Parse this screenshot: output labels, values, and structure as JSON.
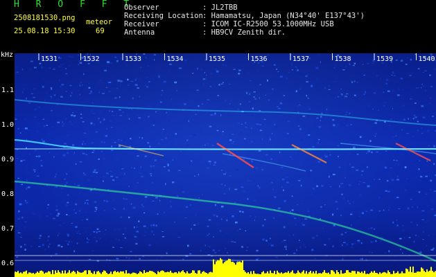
{
  "header": {
    "logo": "H R O F F T",
    "filename": "2508181530.png",
    "timestamp": "25.08.18 15:30",
    "meteor_label": "meteor",
    "meteor_count": "69",
    "info_labels": [
      "Observer",
      "Receiving Location",
      "Receiver",
      "Antenna"
    ],
    "info_values": [
      ": JL2TBB",
      ": Hamamatsu, Japan (N34°40' E137°43')",
      ": ICOM IC-R2500 53.1000MHz USB",
      ": HB9CV Zenith dir."
    ]
  },
  "spectrogram": {
    "unit_label": "kHz",
    "y_ticks": [
      "1.1",
      "1.0",
      "0.9",
      "0.8",
      "0.7",
      "0.6"
    ],
    "y_values": [
      1.1,
      1.0,
      0.9,
      0.8,
      0.7,
      0.6
    ],
    "x_ticks": [
      "1531",
      "1532",
      "1533",
      "1534",
      "1535",
      "1536",
      "1537",
      "1538",
      "1539",
      "1540"
    ],
    "colors": {
      "background": "#0c27a6",
      "noise": "#3a7bff",
      "trace": "#35d6ff",
      "meteor": "#ff4040",
      "level": "#ffff00",
      "label": "#ffff30"
    }
  }
}
